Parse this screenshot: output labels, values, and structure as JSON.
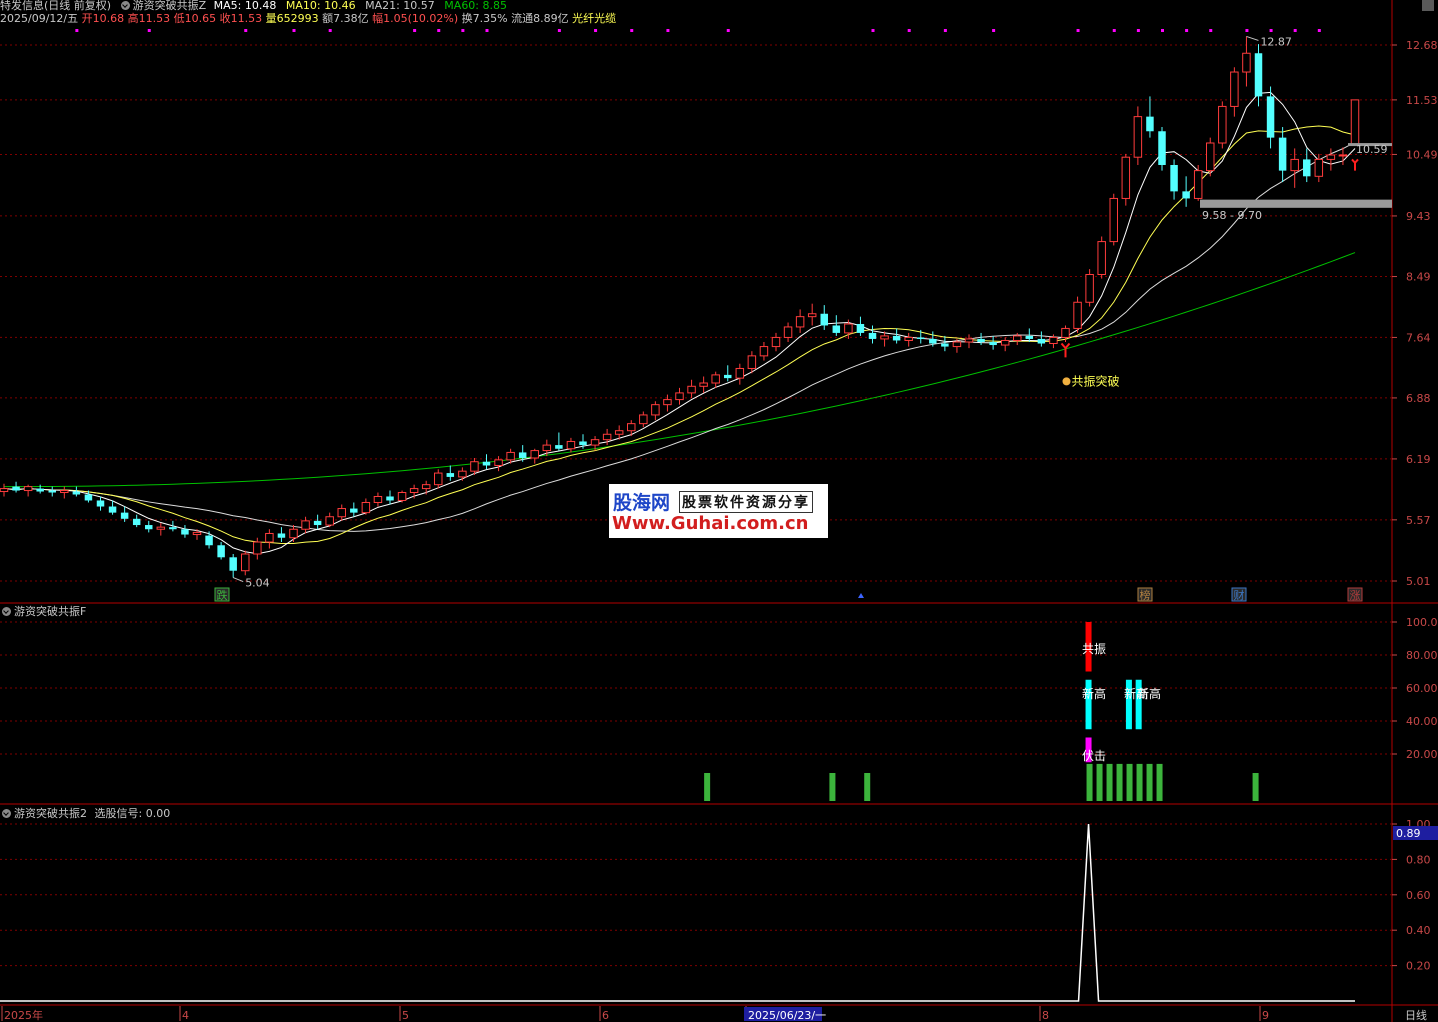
{
  "header": {
    "name_label": "特发信息(日线 前复权)",
    "formula_label": "游资突破共振Z",
    "ma5": "MA5: 10.48",
    "ma10": "MA10: 10.46",
    "ma21": "MA21: 10.57",
    "ma60": "MA60: 8.85",
    "date": "2025/09/12/五",
    "open": "开10.68",
    "high": "高11.53",
    "low": "低10.65",
    "close": "收11.53",
    "volume": "量652993",
    "amount": "额7.38亿",
    "change": "幅1.05(10.02%)",
    "turnover": "换7.35%",
    "float": "流通8.89亿",
    "concept": "光纤光缆"
  },
  "watermark": {
    "logo": "股海网",
    "slogan": "股票软件资源分享",
    "url": "Www.Guhai.com.cn"
  },
  "colors": {
    "up": "#ff3c3c",
    "down": "#54ffff",
    "ma5": "#ffffff",
    "ma10": "#ffff54",
    "ma21": "#ffffff",
    "ma60": "#00c000",
    "grid": "#800000",
    "axis": "#c84848"
  },
  "panels": {
    "main": {
      "y_ticks": [
        "12.68",
        "11.53",
        "10.49",
        "9.43",
        "8.49",
        "7.64",
        "6.88",
        "6.19",
        "5.57",
        "5.01"
      ],
      "labels": {
        "high_label": "12.87",
        "low_label": "5.04",
        "price_tag": "10.59",
        "support_label": "9.58 - 9.70",
        "breakout_label": "共振突破"
      },
      "markers": [
        "跌",
        "榜",
        "财",
        "涨"
      ]
    },
    "ind1": {
      "title": "游资突破共振F",
      "y_ticks": [
        "100.00",
        "80.00",
        "60.00",
        "40.00",
        "20.00"
      ],
      "labels": {
        "gongzhen": "共振",
        "xingao1": "新高",
        "xingao2": "新高",
        "xingao3": "新高",
        "fuji": "伏击"
      }
    },
    "ind2": {
      "title": "游资突破共振2",
      "signal_label": "选股信号: 0.00",
      "y_ticks": [
        "1.00",
        "0.80",
        "0.60",
        "0.40",
        "0.20"
      ],
      "current_value": "0.89"
    }
  },
  "x_axis": {
    "labels": [
      "2025年",
      "4",
      "5",
      "6",
      "2025/06/23/一",
      "8",
      "9"
    ],
    "period": "日线"
  },
  "chart_data": [
    {
      "type": "candlestick",
      "title": "特发信息(日线 前复权)",
      "ylim": [
        5.0,
        12.9
      ],
      "dates_note": "2025-01 to 2025-09-12 daily",
      "ohlc": [
        [
          5.85,
          5.93,
          5.8,
          5.88
        ],
        [
          5.9,
          5.95,
          5.84,
          5.86
        ],
        [
          5.86,
          5.92,
          5.8,
          5.9
        ],
        [
          5.88,
          5.92,
          5.83,
          5.85
        ],
        [
          5.86,
          5.9,
          5.8,
          5.84
        ],
        [
          5.84,
          5.9,
          5.78,
          5.86
        ],
        [
          5.85,
          5.9,
          5.8,
          5.82
        ],
        [
          5.82,
          5.86,
          5.74,
          5.76
        ],
        [
          5.76,
          5.8,
          5.66,
          5.7
        ],
        [
          5.7,
          5.76,
          5.62,
          5.64
        ],
        [
          5.64,
          5.7,
          5.55,
          5.58
        ],
        [
          5.58,
          5.62,
          5.5,
          5.52
        ],
        [
          5.52,
          5.56,
          5.45,
          5.48
        ],
        [
          5.48,
          5.54,
          5.42,
          5.5
        ],
        [
          5.5,
          5.56,
          5.46,
          5.48
        ],
        [
          5.48,
          5.52,
          5.4,
          5.43
        ],
        [
          5.43,
          5.48,
          5.38,
          5.45
        ],
        [
          5.42,
          5.46,
          5.3,
          5.33
        ],
        [
          5.33,
          5.36,
          5.2,
          5.22
        ],
        [
          5.22,
          5.25,
          5.04,
          5.1
        ],
        [
          5.1,
          5.28,
          5.06,
          5.25
        ],
        [
          5.25,
          5.4,
          5.2,
          5.36
        ],
        [
          5.36,
          5.48,
          5.3,
          5.44
        ],
        [
          5.44,
          5.5,
          5.36,
          5.4
        ],
        [
          5.4,
          5.52,
          5.36,
          5.48
        ],
        [
          5.48,
          5.6,
          5.44,
          5.56
        ],
        [
          5.56,
          5.62,
          5.48,
          5.52
        ],
        [
          5.52,
          5.64,
          5.5,
          5.6
        ],
        [
          5.6,
          5.72,
          5.56,
          5.68
        ],
        [
          5.68,
          5.74,
          5.6,
          5.64
        ],
        [
          5.64,
          5.78,
          5.62,
          5.74
        ],
        [
          5.74,
          5.84,
          5.7,
          5.8
        ],
        [
          5.8,
          5.86,
          5.72,
          5.76
        ],
        [
          5.76,
          5.86,
          5.74,
          5.84
        ],
        [
          5.84,
          5.92,
          5.78,
          5.88
        ],
        [
          5.88,
          5.96,
          5.82,
          5.92
        ],
        [
          5.92,
          6.08,
          5.88,
          6.04
        ],
        [
          6.04,
          6.12,
          5.96,
          6.0
        ],
        [
          6.0,
          6.1,
          5.96,
          6.06
        ],
        [
          6.06,
          6.2,
          6.02,
          6.16
        ],
        [
          6.16,
          6.24,
          6.08,
          6.12
        ],
        [
          6.12,
          6.22,
          6.06,
          6.18
        ],
        [
          6.18,
          6.3,
          6.14,
          6.26
        ],
        [
          6.26,
          6.34,
          6.16,
          6.2
        ],
        [
          6.2,
          6.3,
          6.14,
          6.28
        ],
        [
          6.28,
          6.4,
          6.22,
          6.34
        ],
        [
          6.34,
          6.48,
          6.28,
          6.3
        ],
        [
          6.3,
          6.42,
          6.26,
          6.38
        ],
        [
          6.38,
          6.46,
          6.3,
          6.34
        ],
        [
          6.34,
          6.44,
          6.28,
          6.4
        ],
        [
          6.4,
          6.52,
          6.34,
          6.46
        ],
        [
          6.46,
          6.56,
          6.4,
          6.5
        ],
        [
          6.5,
          6.62,
          6.44,
          6.58
        ],
        [
          6.58,
          6.72,
          6.54,
          6.68
        ],
        [
          6.68,
          6.84,
          6.62,
          6.8
        ],
        [
          6.8,
          6.92,
          6.72,
          6.86
        ],
        [
          6.86,
          7.0,
          6.8,
          6.94
        ],
        [
          6.94,
          7.1,
          6.88,
          7.02
        ],
        [
          7.02,
          7.14,
          6.94,
          7.06
        ],
        [
          7.06,
          7.2,
          7.0,
          7.16
        ],
        [
          7.16,
          7.28,
          7.08,
          7.12
        ],
        [
          7.12,
          7.3,
          7.04,
          7.24
        ],
        [
          7.24,
          7.46,
          7.18,
          7.4
        ],
        [
          7.4,
          7.58,
          7.34,
          7.52
        ],
        [
          7.52,
          7.7,
          7.46,
          7.64
        ],
        [
          7.64,
          7.84,
          7.58,
          7.78
        ],
        [
          7.78,
          8.02,
          7.7,
          7.92
        ],
        [
          7.92,
          8.1,
          7.8,
          7.96
        ],
        [
          7.96,
          8.08,
          7.74,
          7.8
        ],
        [
          7.8,
          7.94,
          7.66,
          7.7
        ],
        [
          7.7,
          7.88,
          7.62,
          7.82
        ],
        [
          7.82,
          7.92,
          7.66,
          7.7
        ],
        [
          7.7,
          7.8,
          7.56,
          7.62
        ],
        [
          7.62,
          7.72,
          7.52,
          7.66
        ],
        [
          7.66,
          7.76,
          7.56,
          7.6
        ],
        [
          7.6,
          7.7,
          7.52,
          7.64
        ],
        [
          7.64,
          7.74,
          7.56,
          7.62
        ],
        [
          7.62,
          7.72,
          7.52,
          7.56
        ],
        [
          7.56,
          7.66,
          7.46,
          7.52
        ],
        [
          7.52,
          7.62,
          7.44,
          7.58
        ],
        [
          7.58,
          7.68,
          7.5,
          7.62
        ],
        [
          7.62,
          7.7,
          7.54,
          7.58
        ],
        [
          7.58,
          7.66,
          7.48,
          7.54
        ],
        [
          7.54,
          7.64,
          7.46,
          7.6
        ],
        [
          7.6,
          7.7,
          7.54,
          7.66
        ],
        [
          7.66,
          7.76,
          7.58,
          7.62
        ],
        [
          7.62,
          7.72,
          7.52,
          7.56
        ],
        [
          7.56,
          7.68,
          7.5,
          7.64
        ],
        [
          7.64,
          7.8,
          7.58,
          7.76
        ],
        [
          7.76,
          8.2,
          7.7,
          8.12
        ],
        [
          8.12,
          8.6,
          8.06,
          8.52
        ],
        [
          8.52,
          9.1,
          8.46,
          9.02
        ],
        [
          9.02,
          9.8,
          8.96,
          9.72
        ],
        [
          9.72,
          10.5,
          9.6,
          10.44
        ],
        [
          10.44,
          11.4,
          10.3,
          11.2
        ],
        [
          11.2,
          11.6,
          10.8,
          10.92
        ],
        [
          10.92,
          11.0,
          10.2,
          10.3
        ],
        [
          10.3,
          10.4,
          9.7,
          9.84
        ],
        [
          9.84,
          10.1,
          9.58,
          9.72
        ],
        [
          9.72,
          10.3,
          9.68,
          10.2
        ],
        [
          10.2,
          10.8,
          10.1,
          10.7
        ],
        [
          10.7,
          11.5,
          10.6,
          11.4
        ],
        [
          11.4,
          12.2,
          11.2,
          12.1
        ],
        [
          12.1,
          12.87,
          11.8,
          12.5
        ],
        [
          12.5,
          12.7,
          11.4,
          11.6
        ],
        [
          11.6,
          11.8,
          10.6,
          10.8
        ],
        [
          10.8,
          11.0,
          10.0,
          10.2
        ],
        [
          10.2,
          10.6,
          9.9,
          10.4
        ],
        [
          10.4,
          10.6,
          10.0,
          10.1
        ],
        [
          10.1,
          10.5,
          10.0,
          10.4
        ],
        [
          10.4,
          10.6,
          10.2,
          10.48
        ],
        [
          10.48,
          10.62,
          10.3,
          10.48
        ],
        [
          10.68,
          11.53,
          10.65,
          11.53
        ]
      ],
      "series": [
        {
          "name": "MA5",
          "last": 10.48
        },
        {
          "name": "MA10",
          "last": 10.46
        },
        {
          "name": "MA21",
          "last": 10.57
        },
        {
          "name": "MA60",
          "last": 8.85
        }
      ]
    },
    {
      "type": "bar",
      "title": "游资突破共振F",
      "ylim": [
        0,
        100
      ],
      "bars": [
        {
          "x": 0.508,
          "from": 0,
          "to": 14,
          "color": "#3cb43c"
        },
        {
          "x": 0.598,
          "from": 0,
          "to": 14,
          "color": "#3cb43c"
        },
        {
          "x": 0.623,
          "from": 0,
          "to": 14,
          "color": "#3cb43c"
        },
        {
          "x": 0.782,
          "from": 70,
          "to": 100,
          "color": "#ff0000"
        },
        {
          "x": 0.782,
          "from": 35,
          "to": 65,
          "color": "#00ffff"
        },
        {
          "x": 0.782,
          "from": 15,
          "to": 30,
          "color": "#ff00ff"
        },
        {
          "x": 0.811,
          "from": 35,
          "to": 65,
          "color": "#00ffff"
        },
        {
          "x": 0.818,
          "from": 35,
          "to": 65,
          "color": "#00ffff"
        },
        {
          "x": 0.902,
          "from": 0,
          "to": 14,
          "color": "#3cb43c"
        }
      ],
      "green_run": {
        "x_from": 0.782,
        "x_to": 0.836,
        "to": 14
      }
    },
    {
      "type": "line",
      "title": "游资突破共振2",
      "ylim": [
        0,
        1.0
      ],
      "spike": {
        "x": 0.782,
        "value": 1.0
      },
      "current": 0.0
    }
  ]
}
